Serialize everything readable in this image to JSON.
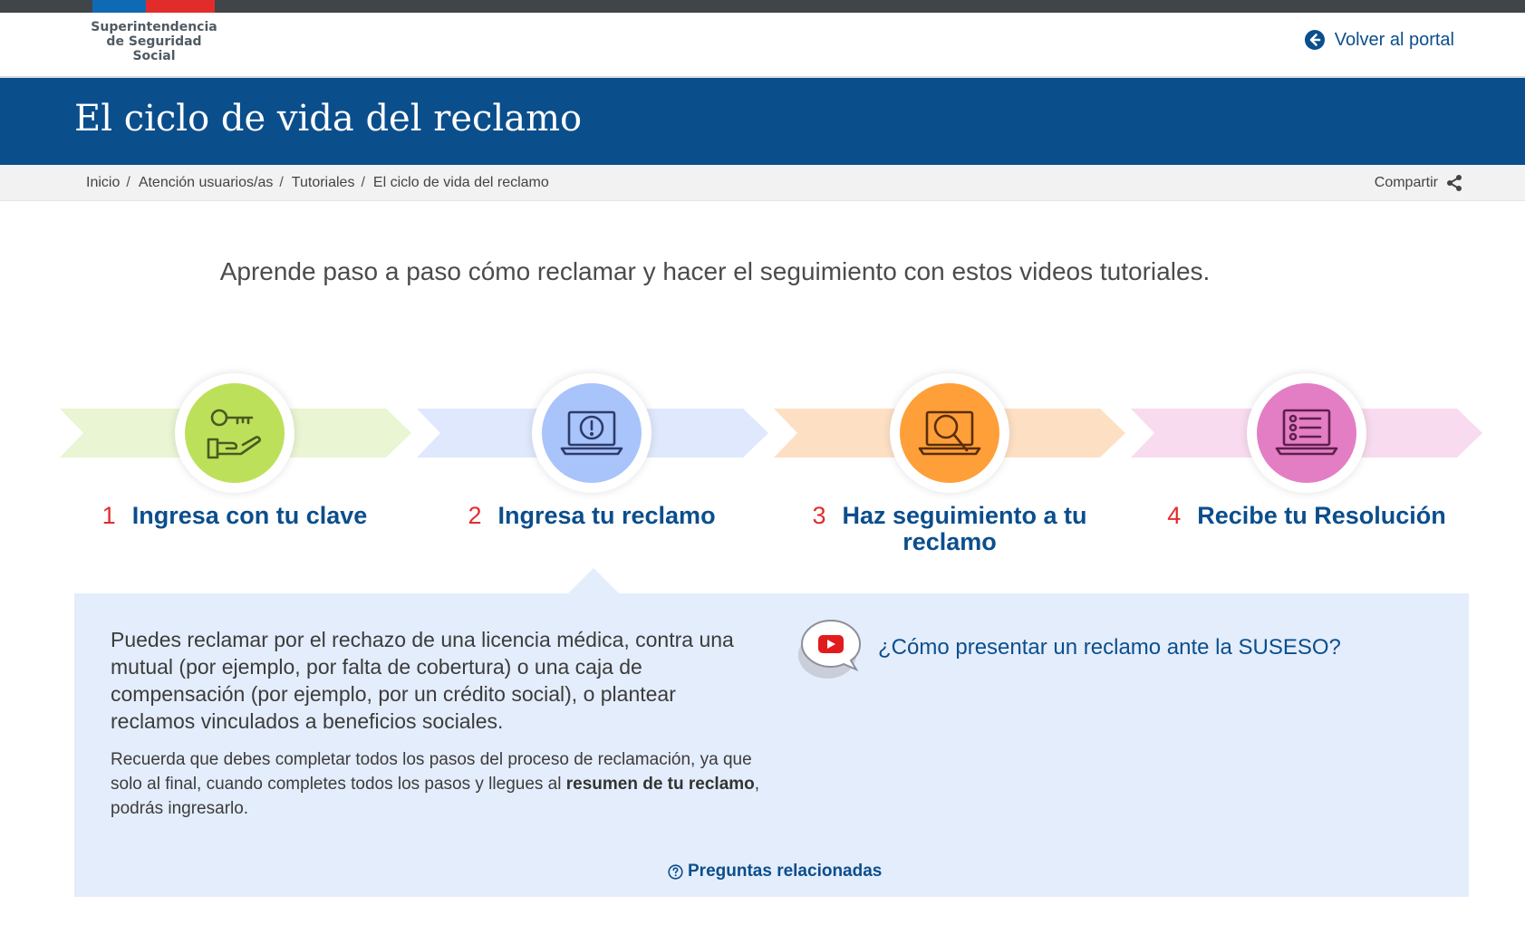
{
  "header": {
    "logo_lines": [
      "Superintendencia",
      "de Seguridad",
      "Social"
    ],
    "back_label": "Volver al portal"
  },
  "banner": {
    "title": "El ciclo de vida del reclamo"
  },
  "breadcrumb": {
    "items": [
      "Inicio",
      "Atención usuarios/as",
      "Tutoriales",
      "El ciclo de vida del reclamo"
    ],
    "share_label": "Compartir"
  },
  "intro": "Aprende paso a paso cómo reclamar y hacer el seguimiento con estos videos tutoriales.",
  "steps": [
    {
      "number": "1",
      "label": "Ingresa con tu clave",
      "icon": "key-hand-icon",
      "color": "#bde05a",
      "chevron_color": "#e9f5d3"
    },
    {
      "number": "2",
      "label": "Ingresa tu reclamo",
      "icon": "laptop-alert-icon",
      "color": "#a9c3fb",
      "chevron_color": "#dfe8fc"
    },
    {
      "number": "3",
      "label": "Haz seguimiento a tu reclamo",
      "icon": "laptop-search-icon",
      "color": "#ff9f3a",
      "chevron_color": "#fde0c4"
    },
    {
      "number": "4",
      "label": "Recibe tu Resolución",
      "icon": "laptop-checklist-icon",
      "color": "#e37ec4",
      "chevron_color": "#f8dbee"
    }
  ],
  "panel": {
    "main_text": "Puedes reclamar por el rechazo de una licencia médica, contra una mutual (por ejemplo, por falta de cobertura) o una caja de compensación (por ejemplo, por un crédito social), o plantear reclamos vinculados a beneficios sociales.",
    "note_before": "Recuerda que debes completar todos los pasos del proceso de reclamación, ya que solo al final, cuando completes todos los pasos y llegues al ",
    "note_bold": "resumen de tu reclamo",
    "note_after": ", podrás ingresarlo.",
    "video_label": "¿Cómo presentar un reclamo ante la SUSESO?",
    "related_label": "Preguntas relacionadas"
  },
  "colors": {
    "brand_blue": "#0b4e8c",
    "accent_red": "#e22c2c",
    "panel_bg": "#e4edfb"
  }
}
